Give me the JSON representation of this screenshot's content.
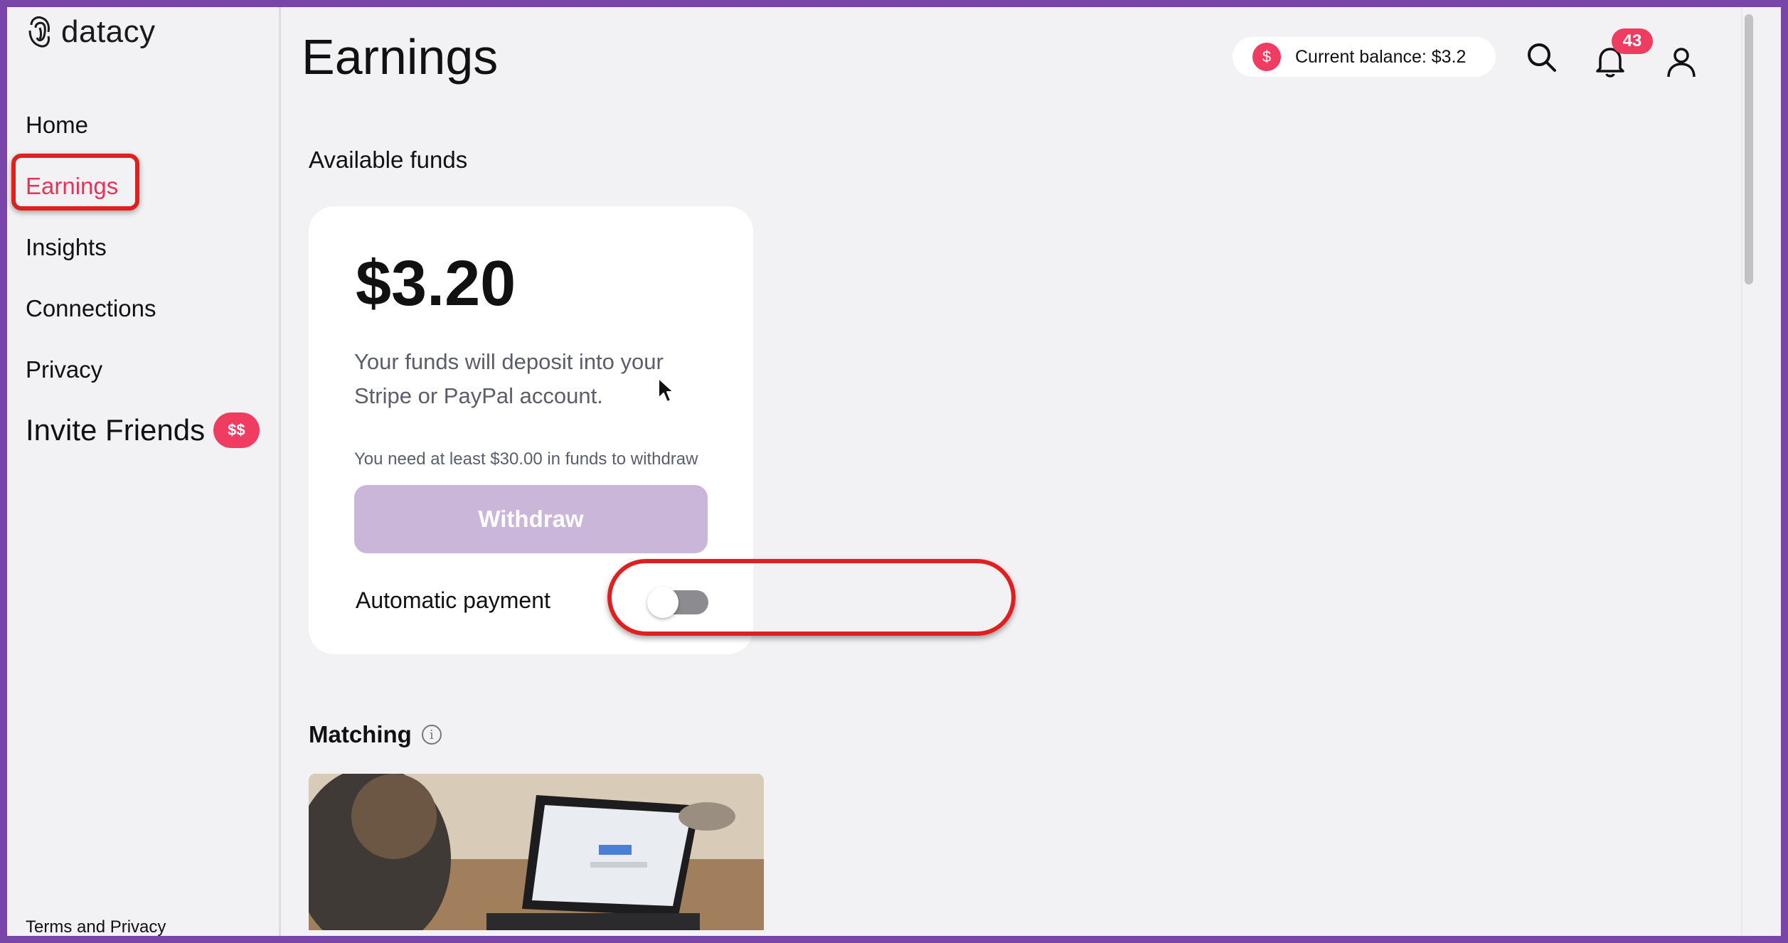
{
  "app": {
    "logo_text": "datacy"
  },
  "sidebar": {
    "items": [
      {
        "label": "Home"
      },
      {
        "label": "Earnings"
      },
      {
        "label": "Insights"
      },
      {
        "label": "Connections"
      },
      {
        "label": "Privacy"
      }
    ],
    "invite_label": "Invite Friends",
    "invite_badge": "$$",
    "footer_link": "Terms and Privacy"
  },
  "header": {
    "title": "Earnings",
    "balance_label": "Current balance: $3.2",
    "balance_icon": "$",
    "notification_count": "43"
  },
  "funds": {
    "section_title": "Available funds",
    "amount": "$3.20",
    "description": "Your funds will deposit into your Stripe or PayPal account.",
    "minimum_note": "You need at least $30.00 in funds to withdraw",
    "withdraw_label": "Withdraw",
    "auto_payment_label": "Automatic payment"
  },
  "matching": {
    "title": "Matching",
    "info_icon": "i"
  },
  "colors": {
    "accent": "#f03c61",
    "withdraw_disabled": "#c9b6d9",
    "frame": "#7a45a8",
    "annotation": "#e02020"
  }
}
